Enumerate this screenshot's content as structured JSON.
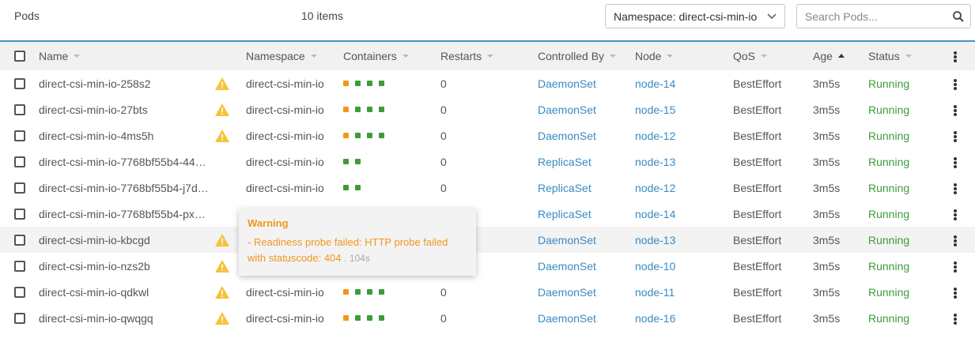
{
  "header": {
    "title": "Pods",
    "count": "10 items",
    "namespace_select": "Namespace: direct-csi-min-io",
    "search_placeholder": "Search Pods..."
  },
  "columns": {
    "name": "Name",
    "namespace": "Namespace",
    "containers": "Containers",
    "restarts": "Restarts",
    "controlled_by": "Controlled By",
    "node": "Node",
    "qos": "QoS",
    "age": "Age",
    "status": "Status"
  },
  "colors": {
    "accent": "#4a90c2",
    "link": "#3a8ac4",
    "running": "#3f9b3a",
    "warning": "#f0961e",
    "container_orange": "#f0961e",
    "container_green": "#3f9b3a"
  },
  "rows": [
    {
      "name": "direct-csi-min-io-258s2",
      "warning": true,
      "namespace": "direct-csi-min-io",
      "containers": [
        "orange",
        "green",
        "green",
        "green"
      ],
      "restarts": "0",
      "controlled_by": "DaemonSet",
      "node": "node-14",
      "qos": "BestEffort",
      "age": "3m5s",
      "status": "Running"
    },
    {
      "name": "direct-csi-min-io-27bts",
      "warning": true,
      "namespace": "direct-csi-min-io",
      "containers": [
        "orange",
        "green",
        "green",
        "green"
      ],
      "restarts": "0",
      "controlled_by": "DaemonSet",
      "node": "node-15",
      "qos": "BestEffort",
      "age": "3m5s",
      "status": "Running"
    },
    {
      "name": "direct-csi-min-io-4ms5h",
      "warning": true,
      "namespace": "direct-csi-min-io",
      "containers": [
        "orange",
        "green",
        "green",
        "green"
      ],
      "restarts": "0",
      "controlled_by": "DaemonSet",
      "node": "node-12",
      "qos": "BestEffort",
      "age": "3m5s",
      "status": "Running"
    },
    {
      "name": "direct-csi-min-io-7768bf55b4-44…",
      "warning": false,
      "namespace": "direct-csi-min-io",
      "containers": [
        "green",
        "green"
      ],
      "restarts": "0",
      "controlled_by": "ReplicaSet",
      "node": "node-13",
      "qos": "BestEffort",
      "age": "3m5s",
      "status": "Running"
    },
    {
      "name": "direct-csi-min-io-7768bf55b4-j7d…",
      "warning": false,
      "namespace": "direct-csi-min-io",
      "containers": [
        "green",
        "green"
      ],
      "restarts": "0",
      "controlled_by": "ReplicaSet",
      "node": "node-12",
      "qos": "BestEffort",
      "age": "3m5s",
      "status": "Running"
    },
    {
      "name": "direct-csi-min-io-7768bf55b4-px…",
      "warning": false,
      "namespace": "",
      "containers": [],
      "restarts": "",
      "controlled_by": "ReplicaSet",
      "node": "node-14",
      "qos": "BestEffort",
      "age": "3m5s",
      "status": "Running"
    },
    {
      "name": "direct-csi-min-io-kbcgd",
      "warning": true,
      "namespace": "",
      "containers": [],
      "restarts": "",
      "controlled_by": "DaemonSet",
      "node": "node-13",
      "qos": "BestEffort",
      "age": "3m5s",
      "status": "Running",
      "highlighted": true
    },
    {
      "name": "direct-csi-min-io-nzs2b",
      "warning": true,
      "namespace": "",
      "containers": [],
      "restarts": "",
      "controlled_by": "DaemonSet",
      "node": "node-10",
      "qos": "BestEffort",
      "age": "3m5s",
      "status": "Running"
    },
    {
      "name": "direct-csi-min-io-qdkwl",
      "warning": true,
      "namespace": "direct-csi-min-io",
      "containers": [
        "orange",
        "green",
        "green",
        "green"
      ],
      "restarts": "0",
      "controlled_by": "DaemonSet",
      "node": "node-11",
      "qos": "BestEffort",
      "age": "3m5s",
      "status": "Running"
    },
    {
      "name": "direct-csi-min-io-qwqgq",
      "warning": true,
      "namespace": "direct-csi-min-io",
      "containers": [
        "orange",
        "green",
        "green",
        "green"
      ],
      "restarts": "0",
      "controlled_by": "DaemonSet",
      "node": "node-16",
      "qos": "BestEffort",
      "age": "3m5s",
      "status": "Running"
    }
  ],
  "tooltip": {
    "title": "Warning",
    "message": "- Readiness probe failed: HTTP probe failed with statuscode: 404",
    "age": ". 104s"
  }
}
